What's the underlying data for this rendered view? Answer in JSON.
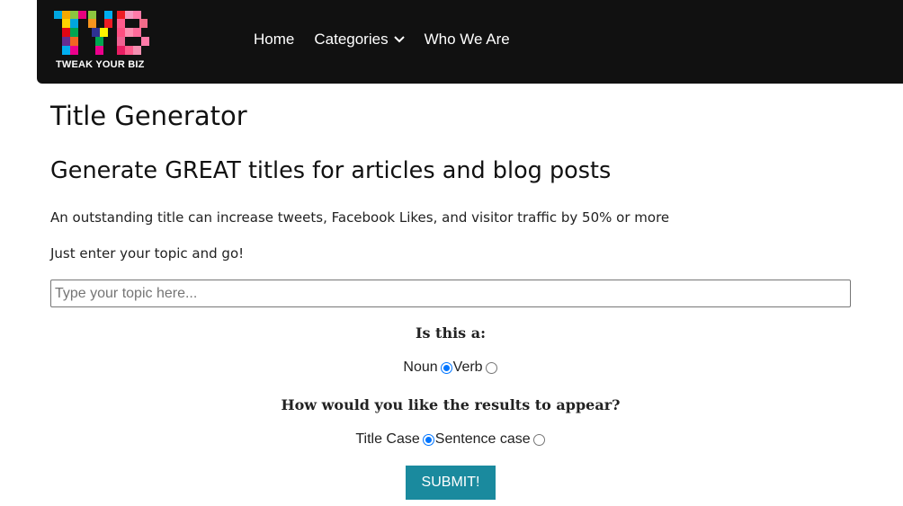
{
  "header": {
    "logo_text": "TWEAK YOUR BIZ",
    "nav": [
      {
        "label": "Home"
      },
      {
        "label": "Categories",
        "has_dropdown": true
      },
      {
        "label": "Who We Are"
      }
    ]
  },
  "main": {
    "title": "Title Generator",
    "subtitle": "Generate GREAT titles for articles and blog posts",
    "intro": "An outstanding title can increase tweets, Facebook Likes, and visitor traffic by 50% or more",
    "cta": "Just enter your topic and go!",
    "topic_input": {
      "placeholder": "Type your topic here...",
      "value": ""
    },
    "question1": "Is this a:",
    "word_type_options": [
      {
        "label": "Noun",
        "checked": true
      },
      {
        "label": "Verb",
        "checked": false
      }
    ],
    "question2": "How would you like the results to appear?",
    "case_options": [
      {
        "label": "Title Case",
        "checked": true
      },
      {
        "label": "Sentence case",
        "checked": false
      }
    ],
    "submit_label": "SUBMIT!"
  },
  "colors": {
    "header_bg": "#111111",
    "submit_bg": "#1a8a9e",
    "radio_accent": "#0075ff"
  },
  "icons": [
    "tyb-logo",
    "chevron-down-icon"
  ]
}
